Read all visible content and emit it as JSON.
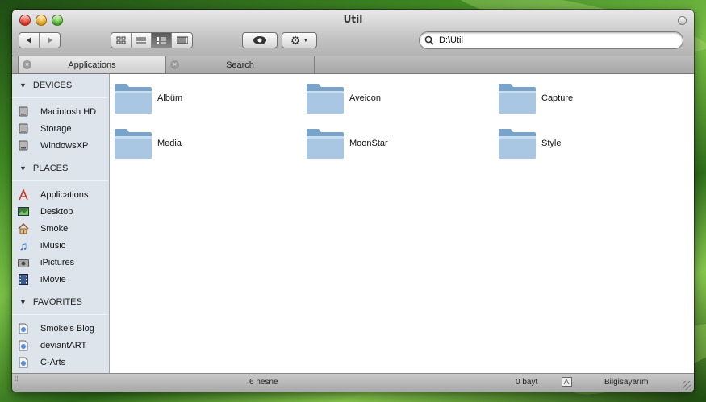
{
  "window": {
    "title": "Util"
  },
  "toolbar": {
    "back_icon": "back-arrow-icon",
    "forward_icon": "forward-arrow-icon",
    "view_modes": [
      "icon-view",
      "list-view",
      "column-view",
      "coverflow-view"
    ],
    "active_view": "column-view",
    "quicklook_icon": "eye-icon",
    "action_icon": "gear-icon"
  },
  "search": {
    "value": "D:\\Util"
  },
  "tabs": [
    {
      "label": "Applications",
      "active": true
    },
    {
      "label": "Search",
      "active": false
    }
  ],
  "sidebar": {
    "sections": [
      {
        "title": "DEVICES",
        "items": [
          {
            "label": "Macintosh HD",
            "icon": "hard-drive-icon"
          },
          {
            "label": "Storage",
            "icon": "hard-drive-icon"
          },
          {
            "label": "WindowsXP",
            "icon": "hard-drive-icon"
          }
        ]
      },
      {
        "title": "PLACES",
        "items": [
          {
            "label": "Applications",
            "icon": "applications-icon"
          },
          {
            "label": "Desktop",
            "icon": "desktop-icon"
          },
          {
            "label": "Smoke",
            "icon": "home-icon"
          },
          {
            "label": "iMusic",
            "icon": "music-note-icon"
          },
          {
            "label": "iPictures",
            "icon": "camera-icon"
          },
          {
            "label": "iMovie",
            "icon": "film-icon"
          }
        ]
      },
      {
        "title": "FAVORITES",
        "items": [
          {
            "label": "Smoke's Blog",
            "icon": "web-link-icon"
          },
          {
            "label": "deviantART",
            "icon": "web-link-icon"
          },
          {
            "label": "C-Arts",
            "icon": "web-link-icon"
          }
        ]
      }
    ]
  },
  "folders": [
    {
      "label": "Albüm"
    },
    {
      "label": "Aveicon"
    },
    {
      "label": "Capture"
    },
    {
      "label": "Media"
    },
    {
      "label": "MoonStar"
    },
    {
      "label": "Style"
    }
  ],
  "status": {
    "count": "6 nesne",
    "size": "0 bayt",
    "location": "Bilgisayarım"
  },
  "colors": {
    "sidebar_bg": "#dde4ec",
    "folder_blue": "#8fb3d4",
    "chrome": "#c4c4c4"
  }
}
